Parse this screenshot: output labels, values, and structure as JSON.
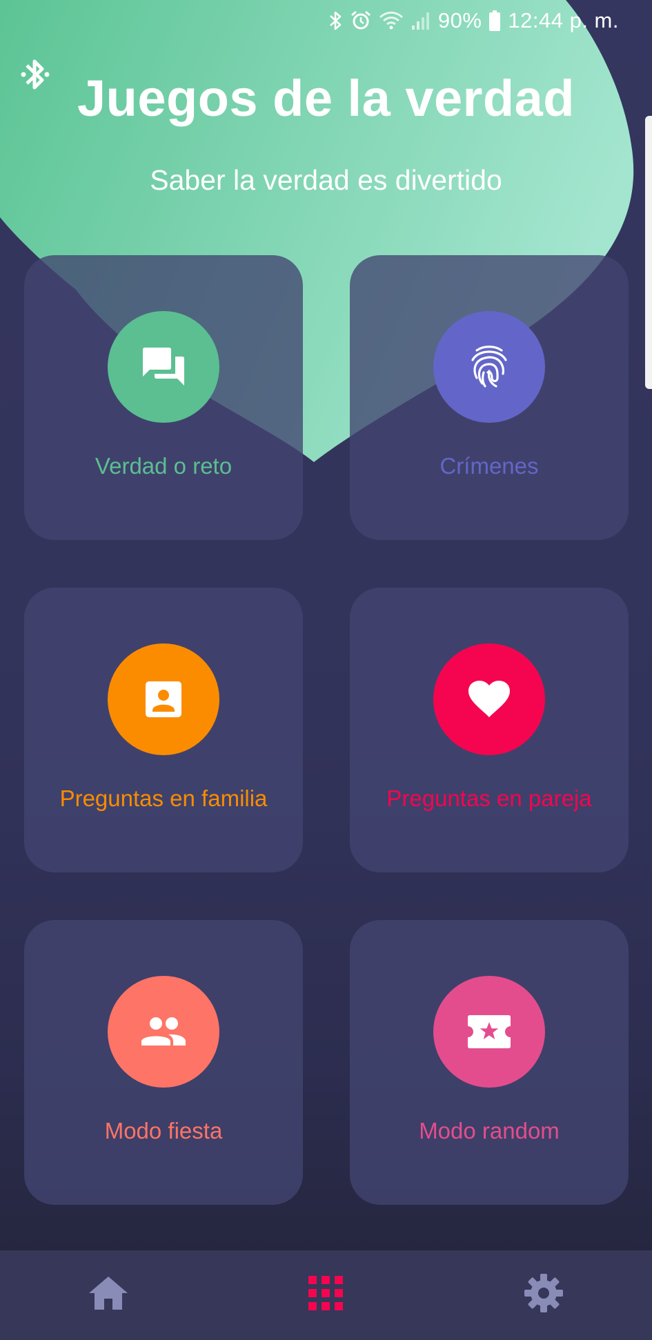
{
  "status_bar": {
    "battery": "90%",
    "time": "12:44 p. m.",
    "icons": [
      "bluetooth-icon",
      "alarm-icon",
      "wifi-icon",
      "signal-icon",
      "battery-icon"
    ]
  },
  "header": {
    "title": "Juegos de la verdad",
    "subtitle": "Saber la verdad es divertido",
    "corner_icon": "bluetooth-icon"
  },
  "games": [
    {
      "label": "Verdad o reto",
      "color": "#5bbf91",
      "icon": "chat-bubbles-icon"
    },
    {
      "label": "Crímenes",
      "color": "#6366c8",
      "icon": "fingerprint-icon"
    },
    {
      "label": "Preguntas en familia",
      "color": "#fb8c00",
      "icon": "contact-card-icon"
    },
    {
      "label": "Preguntas en pareja",
      "color": "#f5054f",
      "icon": "heart-icon"
    },
    {
      "label": "Modo fiesta",
      "color": "#fe7466",
      "icon": "people-icon"
    },
    {
      "label": "Modo random",
      "color": "#e44d8d",
      "icon": "ticket-star-icon"
    }
  ],
  "bottom_nav": {
    "items": [
      {
        "name": "home",
        "icon": "home-icon",
        "color": "#8a8cb8"
      },
      {
        "name": "games",
        "icon": "grid-icon",
        "color": "#f5054f",
        "active": true
      },
      {
        "name": "settings",
        "icon": "gear-icon",
        "color": "#8a8cb8"
      }
    ]
  },
  "colors": {
    "background": "#35365f",
    "card": "#434571",
    "header_blob": "#6fcfa4"
  }
}
